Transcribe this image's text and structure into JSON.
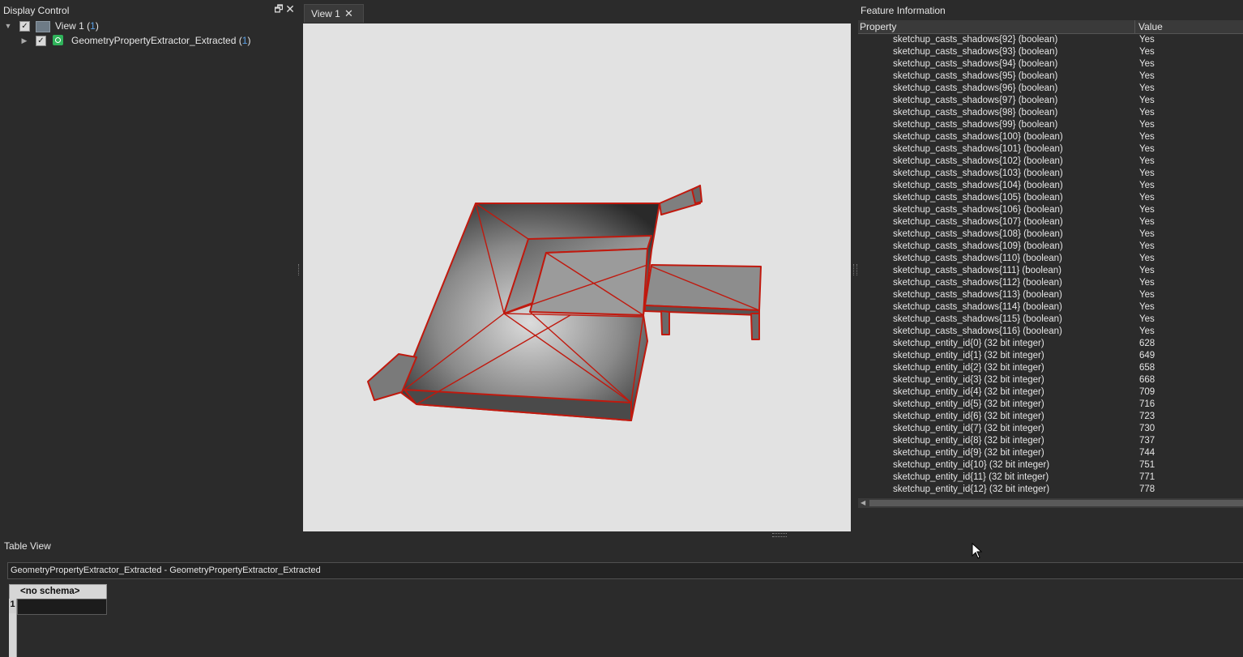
{
  "display_control": {
    "title": "Display Control",
    "view": {
      "label": "View 1 (",
      "count": "1",
      "close": ")"
    },
    "layer": {
      "label": "GeometryPropertyExtractor_Extracted (",
      "count": "1",
      "close": ")"
    }
  },
  "view_tab": {
    "label": "View 1",
    "close_glyph": "✕"
  },
  "feature_info": {
    "title": "Feature Information",
    "columns": {
      "property": "Property",
      "value": "Value"
    },
    "rows": [
      {
        "p": "sketchup_casts_shadows{92} (boolean)",
        "v": "Yes"
      },
      {
        "p": "sketchup_casts_shadows{93} (boolean)",
        "v": "Yes"
      },
      {
        "p": "sketchup_casts_shadows{94} (boolean)",
        "v": "Yes"
      },
      {
        "p": "sketchup_casts_shadows{95} (boolean)",
        "v": "Yes"
      },
      {
        "p": "sketchup_casts_shadows{96} (boolean)",
        "v": "Yes"
      },
      {
        "p": "sketchup_casts_shadows{97} (boolean)",
        "v": "Yes"
      },
      {
        "p": "sketchup_casts_shadows{98} (boolean)",
        "v": "Yes"
      },
      {
        "p": "sketchup_casts_shadows{99} (boolean)",
        "v": "Yes"
      },
      {
        "p": "sketchup_casts_shadows{100} (boolean)",
        "v": "Yes"
      },
      {
        "p": "sketchup_casts_shadows{101} (boolean)",
        "v": "Yes"
      },
      {
        "p": "sketchup_casts_shadows{102} (boolean)",
        "v": "Yes"
      },
      {
        "p": "sketchup_casts_shadows{103} (boolean)",
        "v": "Yes"
      },
      {
        "p": "sketchup_casts_shadows{104} (boolean)",
        "v": "Yes"
      },
      {
        "p": "sketchup_casts_shadows{105} (boolean)",
        "v": "Yes"
      },
      {
        "p": "sketchup_casts_shadows{106} (boolean)",
        "v": "Yes"
      },
      {
        "p": "sketchup_casts_shadows{107} (boolean)",
        "v": "Yes"
      },
      {
        "p": "sketchup_casts_shadows{108} (boolean)",
        "v": "Yes"
      },
      {
        "p": "sketchup_casts_shadows{109} (boolean)",
        "v": "Yes"
      },
      {
        "p": "sketchup_casts_shadows{110} (boolean)",
        "v": "Yes"
      },
      {
        "p": "sketchup_casts_shadows{111} (boolean)",
        "v": "Yes"
      },
      {
        "p": "sketchup_casts_shadows{112} (boolean)",
        "v": "Yes"
      },
      {
        "p": "sketchup_casts_shadows{113} (boolean)",
        "v": "Yes"
      },
      {
        "p": "sketchup_casts_shadows{114} (boolean)",
        "v": "Yes"
      },
      {
        "p": "sketchup_casts_shadows{115} (boolean)",
        "v": "Yes"
      },
      {
        "p": "sketchup_casts_shadows{116} (boolean)",
        "v": "Yes"
      },
      {
        "p": "sketchup_entity_id{0} (32 bit integer)",
        "v": "628"
      },
      {
        "p": "sketchup_entity_id{1} (32 bit integer)",
        "v": "649"
      },
      {
        "p": "sketchup_entity_id{2} (32 bit integer)",
        "v": "658"
      },
      {
        "p": "sketchup_entity_id{3} (32 bit integer)",
        "v": "668"
      },
      {
        "p": "sketchup_entity_id{4} (32 bit integer)",
        "v": "709"
      },
      {
        "p": "sketchup_entity_id{5} (32 bit integer)",
        "v": "716"
      },
      {
        "p": "sketchup_entity_id{6} (32 bit integer)",
        "v": "723"
      },
      {
        "p": "sketchup_entity_id{7} (32 bit integer)",
        "v": "730"
      },
      {
        "p": "sketchup_entity_id{8} (32 bit integer)",
        "v": "737"
      },
      {
        "p": "sketchup_entity_id{9} (32 bit integer)",
        "v": "744"
      },
      {
        "p": "sketchup_entity_id{10} (32 bit integer)",
        "v": "751"
      },
      {
        "p": "sketchup_entity_id{11} (32 bit integer)",
        "v": "771"
      },
      {
        "p": "sketchup_entity_id{12} (32 bit integer)",
        "v": "778"
      }
    ]
  },
  "table_view": {
    "title": "Table View",
    "dataset": "GeometryPropertyExtractor_Extracted - GeometryPropertyExtractor_Extracted",
    "column_header": "<no schema>",
    "row_number": "1"
  },
  "icons": {
    "float": "float-icon",
    "close": "close-icon",
    "expand": "chevron-down-icon",
    "collapse": "chevron-right-icon",
    "checkbox": "checkbox-checked-icon",
    "view": "view-icon",
    "layer": "layer-icon",
    "cursor": "mouse-cursor-icon"
  },
  "colors": {
    "background": "#2b2b2b",
    "canvas": "#e2e2e2",
    "wireframe": "#c0190e",
    "count_link": "#5aa0e6"
  }
}
